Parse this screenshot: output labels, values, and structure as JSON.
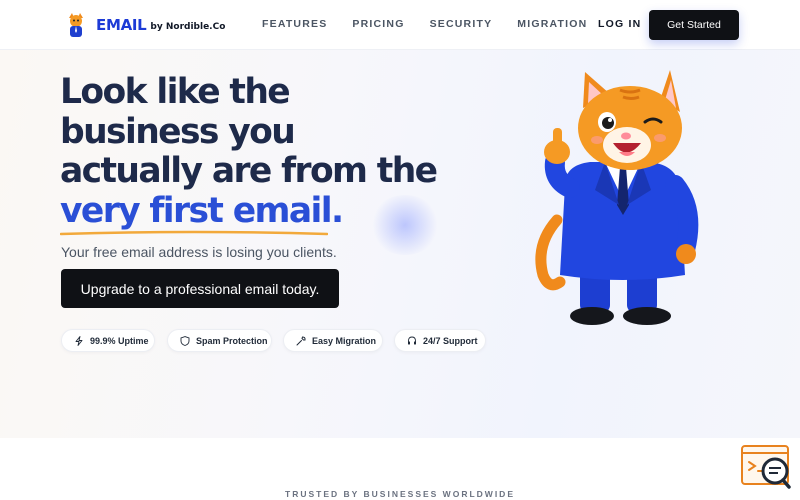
{
  "nav": {
    "logo_text": "EMAIL",
    "logo_sub": "by Nordible.Co",
    "links": [
      "FEATURES",
      "PRICING",
      "SECURITY",
      "MIGRATION"
    ],
    "login": "LOG IN",
    "cta": "Get Started"
  },
  "hero": {
    "headline_line1": "Look like the",
    "headline_line2": "business you",
    "headline_line3": "actually are from the",
    "headline_accent": "very first email.",
    "subtext": "Your free email address is losing you clients.",
    "cta": "Upgrade to a professional email today.",
    "features": [
      {
        "label": "99.9% Uptime",
        "icon": "lightning-icon"
      },
      {
        "label": "Spam Protection",
        "icon": "shield-icon"
      },
      {
        "label": "Easy Migration",
        "icon": "wrench-icon"
      },
      {
        "label": "24/7 Support",
        "icon": "headset-icon"
      }
    ]
  },
  "trusted": "TRUSTED BY BUSINESSES WORLDWIDE",
  "colors": {
    "brand": "#1d3bd6",
    "accent": "#2a4fd6",
    "underline": "#f2a93b",
    "button": "#0f1115"
  }
}
